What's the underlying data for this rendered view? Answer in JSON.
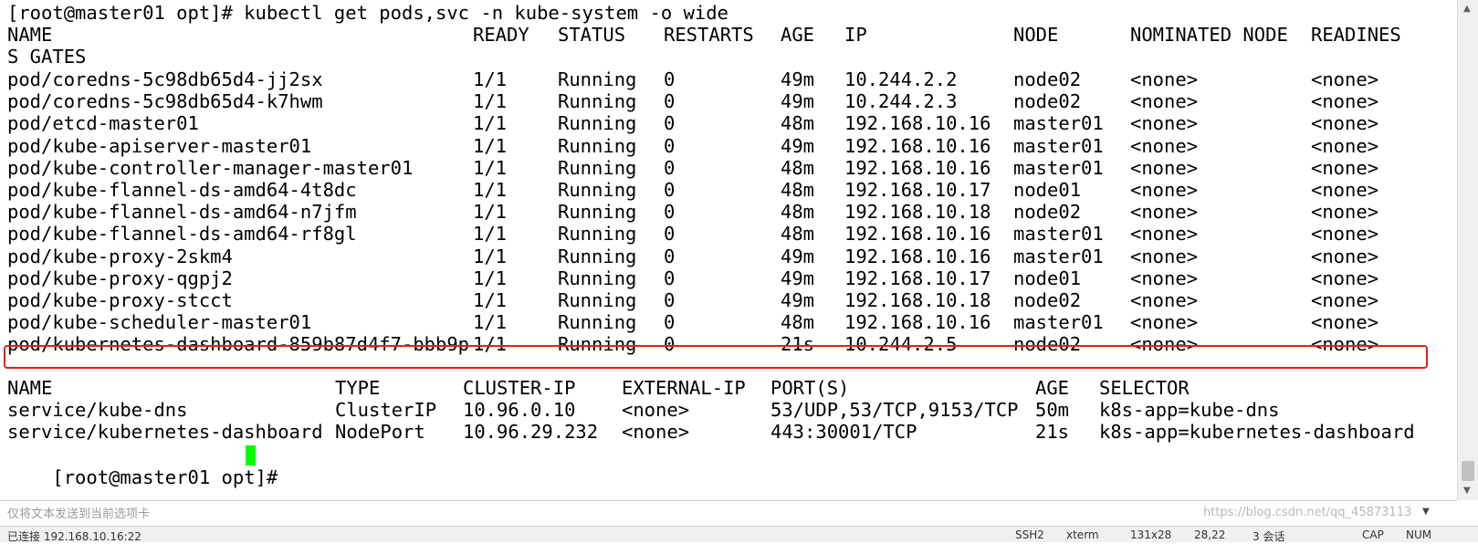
{
  "terminal": {
    "command_prompt": "[root@master01 opt]# kubectl get pods,svc -n kube-system -o wide",
    "pod_headers": [
      "NAME",
      "READY",
      "STATUS",
      "RESTARTS",
      "AGE",
      "IP",
      "NODE",
      "NOMINATED NODE",
      "READINES"
    ],
    "pod_header_wrap": "S GATES",
    "pods": [
      [
        "pod/coredns-5c98db65d4-jj2sx",
        "1/1",
        "Running",
        "0",
        "49m",
        "10.244.2.2",
        "node02",
        "<none>",
        "<none>"
      ],
      [
        "pod/coredns-5c98db65d4-k7hwm",
        "1/1",
        "Running",
        "0",
        "49m",
        "10.244.2.3",
        "node02",
        "<none>",
        "<none>"
      ],
      [
        "pod/etcd-master01",
        "1/1",
        "Running",
        "0",
        "48m",
        "192.168.10.16",
        "master01",
        "<none>",
        "<none>"
      ],
      [
        "pod/kube-apiserver-master01",
        "1/1",
        "Running",
        "0",
        "49m",
        "192.168.10.16",
        "master01",
        "<none>",
        "<none>"
      ],
      [
        "pod/kube-controller-manager-master01",
        "1/1",
        "Running",
        "0",
        "48m",
        "192.168.10.16",
        "master01",
        "<none>",
        "<none>"
      ],
      [
        "pod/kube-flannel-ds-amd64-4t8dc",
        "1/1",
        "Running",
        "0",
        "48m",
        "192.168.10.17",
        "node01",
        "<none>",
        "<none>"
      ],
      [
        "pod/kube-flannel-ds-amd64-n7jfm",
        "1/1",
        "Running",
        "0",
        "48m",
        "192.168.10.18",
        "node02",
        "<none>",
        "<none>"
      ],
      [
        "pod/kube-flannel-ds-amd64-rf8gl",
        "1/1",
        "Running",
        "0",
        "48m",
        "192.168.10.16",
        "master01",
        "<none>",
        "<none>"
      ],
      [
        "pod/kube-proxy-2skm4",
        "1/1",
        "Running",
        "0",
        "49m",
        "192.168.10.16",
        "master01",
        "<none>",
        "<none>"
      ],
      [
        "pod/kube-proxy-qgpj2",
        "1/1",
        "Running",
        "0",
        "49m",
        "192.168.10.17",
        "node01",
        "<none>",
        "<none>"
      ],
      [
        "pod/kube-proxy-stcct",
        "1/1",
        "Running",
        "0",
        "49m",
        "192.168.10.18",
        "node02",
        "<none>",
        "<none>"
      ],
      [
        "pod/kube-scheduler-master01",
        "1/1",
        "Running",
        "0",
        "48m",
        "192.168.10.16",
        "master01",
        "<none>",
        "<none>"
      ],
      [
        "pod/kubernetes-dashboard-859b87d4f7-bbb9p",
        "1/1",
        "Running",
        "0",
        "21s",
        "10.244.2.5",
        "node02",
        "<none>",
        "<none>"
      ]
    ],
    "highlighted_pod_index": 12,
    "svc_headers": [
      "NAME",
      "TYPE",
      "CLUSTER-IP",
      "EXTERNAL-IP",
      "PORT(S)",
      "AGE",
      "SELECTOR"
    ],
    "services": [
      [
        "service/kube-dns",
        "ClusterIP",
        "10.96.0.10",
        "<none>",
        "53/UDP,53/TCP,9153/TCP",
        "50m",
        "k8s-app=kube-dns"
      ],
      [
        "service/kubernetes-dashboard",
        "NodePort",
        "10.96.29.232",
        "<none>",
        "443:30001/TCP",
        "21s",
        "k8s-app=kubernetes-dashboard"
      ]
    ],
    "final_prompt": "[root@master01 opt]# "
  },
  "compose_bar": {
    "placeholder": "仅将文本发送到当前选项卡"
  },
  "status_bar": {
    "connection": "已连接 192.168.10.16:22",
    "protocol": "SSH2",
    "terminal_type": "xterm",
    "size": "131x28",
    "cursor_position": "28,22",
    "sessions": "3 会话",
    "caps": "CAP",
    "num": "NUM"
  },
  "watermark": "https://blog.csdn.net/qq_45873113",
  "colors": {
    "highlight_border": "#e02020",
    "cursor": "#00ff00"
  },
  "icons": {
    "compose_dropdown": "chevron-down-icon",
    "scroll_up": "arrow-up-icon",
    "scroll_down": "arrow-down-icon"
  }
}
